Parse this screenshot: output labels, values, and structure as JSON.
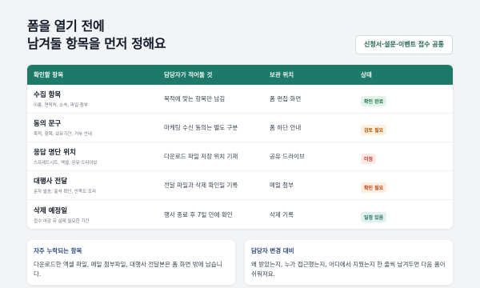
{
  "header": {
    "title_line1": "폼을 열기 전에",
    "title_line2": "남겨둘 항목을 먼저 정해요",
    "scope_label": "신청서·설문·이벤트 접수 공통"
  },
  "table": {
    "columns": [
      "확인할 항목",
      "담당자가 적어둘 것",
      "보관 위치",
      "상태"
    ],
    "rows": [
      {
        "name": "수집 항목",
        "sub": "이름, 연락처, 소속, 파일 첨부",
        "note": "목적에 맞는 항목만 남김",
        "location": "폼 편집 화면",
        "status": "확인 완료",
        "tone": "green"
      },
      {
        "name": "동의 문구",
        "sub": "목적, 항목, 보유기간, 거부 안내",
        "note": "마케팅 수신 동의는 별도 구분",
        "location": "폼 하단 안내",
        "status": "검토 필요",
        "tone": "yellow"
      },
      {
        "name": "응답 명단 위치",
        "sub": "스프레드시트, 엑셀, 공유 드라이브",
        "note": "다운로드 파일 저장 위치 기재",
        "location": "공유 드라이브",
        "status": "미정",
        "tone": "red"
      },
      {
        "name": "대행사 전달",
        "sub": "문자 발송, 출석 확인, 만족도 조사",
        "note": "전달 파일과 삭제 확인일 기록",
        "location": "메일 첨부",
        "status": "확인 필요",
        "tone": "orange"
      },
      {
        "name": "삭제 예정일",
        "sub": "접수 마감 뒤 실제 필요한 기간",
        "note": "행사 종료 후 7일 안에 확인",
        "location": "삭제 기록",
        "status": "일정 있음",
        "tone": "teal"
      }
    ]
  },
  "notes": {
    "left": {
      "title": "자주 누락되는 항목",
      "body": "다운로드한 엑셀 파일, 메일 첨부파일, 대행사 전달본은 폼 화면 밖에 남습니다."
    },
    "right": {
      "title": "담당자 변경 대비",
      "body": "왜 받았는지, 누가 접근했는지, 어디에서 지웠는지 한 줄씩 남겨두면 다음 폼이 쉬워져요."
    }
  }
}
